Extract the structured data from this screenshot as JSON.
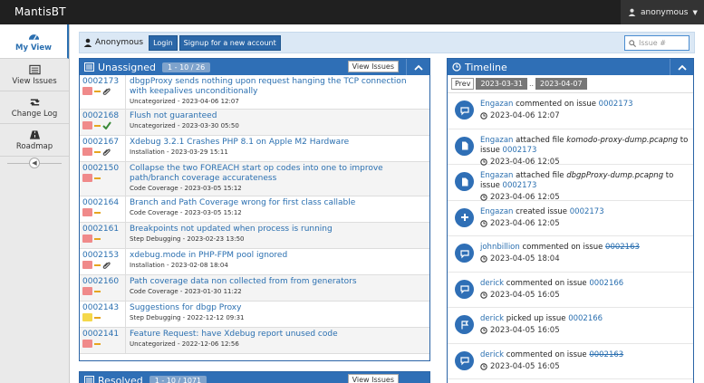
{
  "app": {
    "brand": "MantisBT",
    "user_menu": "anonymous"
  },
  "sidebar": {
    "items": [
      {
        "label": "My View",
        "icon": "tachometer-icon"
      },
      {
        "label": "View Issues",
        "icon": "list-icon"
      },
      {
        "label": "Change Log",
        "icon": "retweet-icon"
      },
      {
        "label": "Roadmap",
        "icon": "road-icon"
      }
    ]
  },
  "breadcrumb": {
    "user": "Anonymous",
    "login": "Login",
    "signup": "Signup for a new account"
  },
  "search": {
    "placeholder": "Issue #"
  },
  "unassigned": {
    "title": "Unassigned",
    "count": "1 - 10 / 26",
    "view_label": "View Issues",
    "rows": [
      {
        "id": "0002173",
        "summary": "dbgpProxy sends nothing upon request hanging the TCP connection with keepalives unconditionally",
        "meta": "Uncategorized - 2023-04-06 12:07",
        "color": "#f08a8a",
        "extra": "paperclip"
      },
      {
        "id": "0002168",
        "summary": "Flush not guaranteed",
        "meta": "Uncategorized - 2023-03-30 05:50",
        "color": "#f08a8a",
        "extra": "check"
      },
      {
        "id": "0002167",
        "summary": "Xdebug 3.2.1 Crashes PHP 8.1 on Apple M2 Hardware",
        "meta": "Installation - 2023-03-29 15:11",
        "color": "#f08a8a",
        "extra": "paperclip"
      },
      {
        "id": "0002150",
        "summary": "Collapse the two FOREACH start op codes into one to improve path/branch coverage accurateness",
        "meta": "Code Coverage - 2023-03-05 15:12",
        "color": "#f08a8a",
        "extra": ""
      },
      {
        "id": "0002164",
        "summary": "Branch and Path Coverage wrong for first class callable",
        "meta": "Code Coverage - 2023-03-05 15:12",
        "color": "#f08a8a",
        "extra": ""
      },
      {
        "id": "0002161",
        "summary": "Breakpoints not updated when process is running",
        "meta": "Step Debugging - 2023-02-23 13:50",
        "color": "#f08a8a",
        "extra": ""
      },
      {
        "id": "0002153",
        "summary": "xdebug.mode in PHP-FPM pool ignored",
        "meta": "Installation - 2023-02-08 18:04",
        "color": "#f08a8a",
        "extra": "paperclip"
      },
      {
        "id": "0002160",
        "summary": "Path coverage data non collected from from generators",
        "meta": "Code Coverage - 2023-01-30 11:22",
        "color": "#f08a8a",
        "extra": ""
      },
      {
        "id": "0002143",
        "summary": "Suggestions for dbgp Proxy",
        "meta": "Step Debugging - 2022-12-12 09:31",
        "color": "#f5d84a",
        "extra": ""
      },
      {
        "id": "0002141",
        "summary": "Feature Request: have Xdebug report unused code",
        "meta": "Uncategorized - 2022-12-06 12:56",
        "color": "#f08a8a",
        "extra": ""
      }
    ]
  },
  "resolved": {
    "title": "Resolved",
    "count": "1 - 10 / 1071",
    "view_label": "View Issues"
  },
  "timeline": {
    "title": "Timeline",
    "prev": "Prev",
    "from": "2023-03-31",
    "sep": "..",
    "to": "2023-04-07",
    "items": [
      {
        "icon": "comment-icon",
        "user": "Engazan",
        "action": " commented on issue ",
        "issue": "0002173",
        "file": "",
        "struck": false,
        "time": "2023-04-06 12:07"
      },
      {
        "icon": "file-icon",
        "user": "Engazan",
        "action": " attached file ",
        "file": "komodo-proxy-dump.pcapng",
        "after": " to issue ",
        "issue": "0002173",
        "struck": false,
        "time": "2023-04-06 12:05"
      },
      {
        "icon": "file-icon",
        "user": "Engazan",
        "action": " attached file ",
        "file": "dbgpProxy-dump.pcapng",
        "after": " to issue ",
        "issue": "0002173",
        "struck": false,
        "time": "2023-04-06 12:05"
      },
      {
        "icon": "plus-icon",
        "user": "Engazan",
        "action": " created issue ",
        "issue": "0002173",
        "file": "",
        "struck": false,
        "time": "2023-04-06 12:05"
      },
      {
        "icon": "comment-icon",
        "user": "johnbillion",
        "action": " commented on issue ",
        "issue": "0002163",
        "file": "",
        "struck": true,
        "time": "2023-04-05 18:04"
      },
      {
        "icon": "comment-icon",
        "user": "derick",
        "action": " commented on issue ",
        "issue": "0002166",
        "file": "",
        "struck": false,
        "time": "2023-04-05 16:05"
      },
      {
        "icon": "flag-icon",
        "user": "derick",
        "action": " picked up issue ",
        "issue": "0002166",
        "file": "",
        "struck": false,
        "time": "2023-04-05 16:05"
      },
      {
        "icon": "comment-icon",
        "user": "derick",
        "action": " commented on issue ",
        "issue": "0002163",
        "file": "",
        "struck": true,
        "time": "2023-04-05 16:05"
      }
    ]
  },
  "colors": {
    "accent": "#2f6fb6",
    "topbar": "#202020"
  }
}
